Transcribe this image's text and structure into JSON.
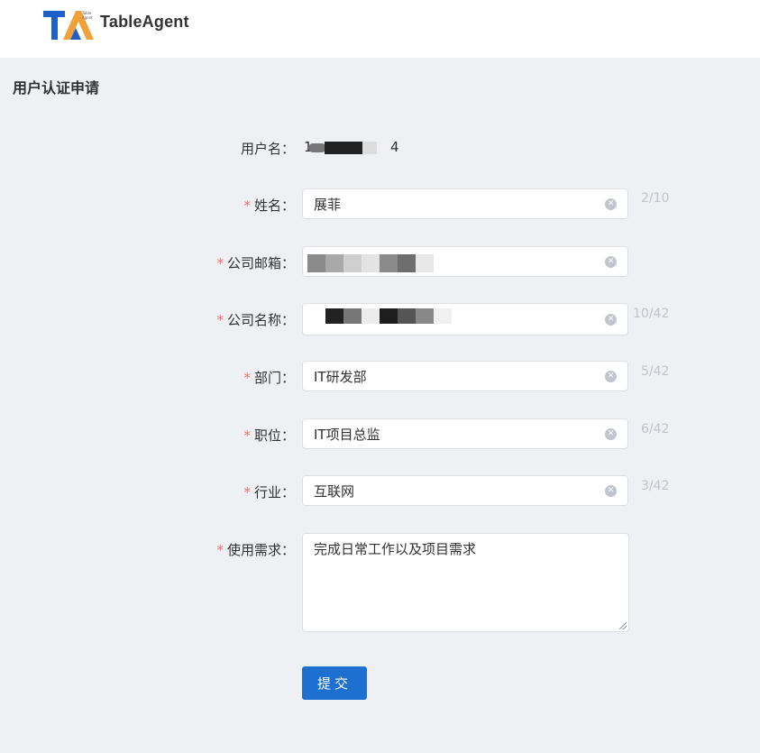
{
  "app": {
    "brand": "TableAgent",
    "logo_small_text": "Table Agent"
  },
  "page": {
    "title": "用户认证申请"
  },
  "form": {
    "username": {
      "label": "用户名：",
      "value_start": "1",
      "value_end": "4"
    },
    "name": {
      "required_mark": "*",
      "label": "姓名：",
      "value": "展菲",
      "count": "2/10"
    },
    "company_email": {
      "required_mark": "*",
      "label": "公司邮箱：",
      "value": ""
    },
    "company_name": {
      "required_mark": "*",
      "label": "公司名称：",
      "value": "",
      "count": "10/42"
    },
    "department": {
      "required_mark": "*",
      "label": "部门：",
      "value": "IT研发部",
      "count": "5/42"
    },
    "position": {
      "required_mark": "*",
      "label": "职位：",
      "value": "IT项目总监",
      "count": "6/42"
    },
    "industry": {
      "required_mark": "*",
      "label": "行业：",
      "value": "互联网",
      "count": "3/42"
    },
    "usage": {
      "required_mark": "*",
      "label": "使用需求：",
      "value": "完成日常工作以及项目需求"
    },
    "clear_icon": "✕",
    "submit_label": "提交"
  },
  "colors": {
    "accent": "#1d6fd0",
    "required": "#f56c6c",
    "logo_blue": "#1f5fc9",
    "logo_orange": "#f0a23a"
  }
}
